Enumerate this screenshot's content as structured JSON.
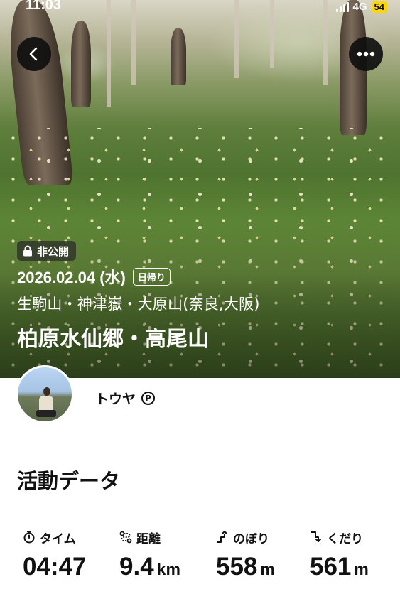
{
  "status_bar": {
    "time": "11:03",
    "network": "4G",
    "battery": "54"
  },
  "hero": {
    "visibility_label": "非公開",
    "date": "2026.02.04 (水)",
    "trip_type": "日帰り",
    "mountains": "生駒山・神津嶽・大原山(奈良,大阪)",
    "title": "柏原水仙郷・高尾山"
  },
  "user": {
    "name": "トウヤ",
    "badge": "P"
  },
  "activity": {
    "section_title": "活動データ",
    "stats": [
      {
        "icon": "stopwatch-icon",
        "label": "タイム",
        "value": "04:47",
        "unit": ""
      },
      {
        "icon": "route-icon",
        "label": "距離",
        "value": "9.4",
        "unit": "km"
      },
      {
        "icon": "ascent-icon",
        "label": "のぼり",
        "value": "558",
        "unit": "m"
      },
      {
        "icon": "descent-icon",
        "label": "くだり",
        "value": "561",
        "unit": "m"
      }
    ]
  },
  "colors": {
    "battery": "#ffd60a",
    "button_bg": "#0f0f0f",
    "text": "#111111"
  }
}
